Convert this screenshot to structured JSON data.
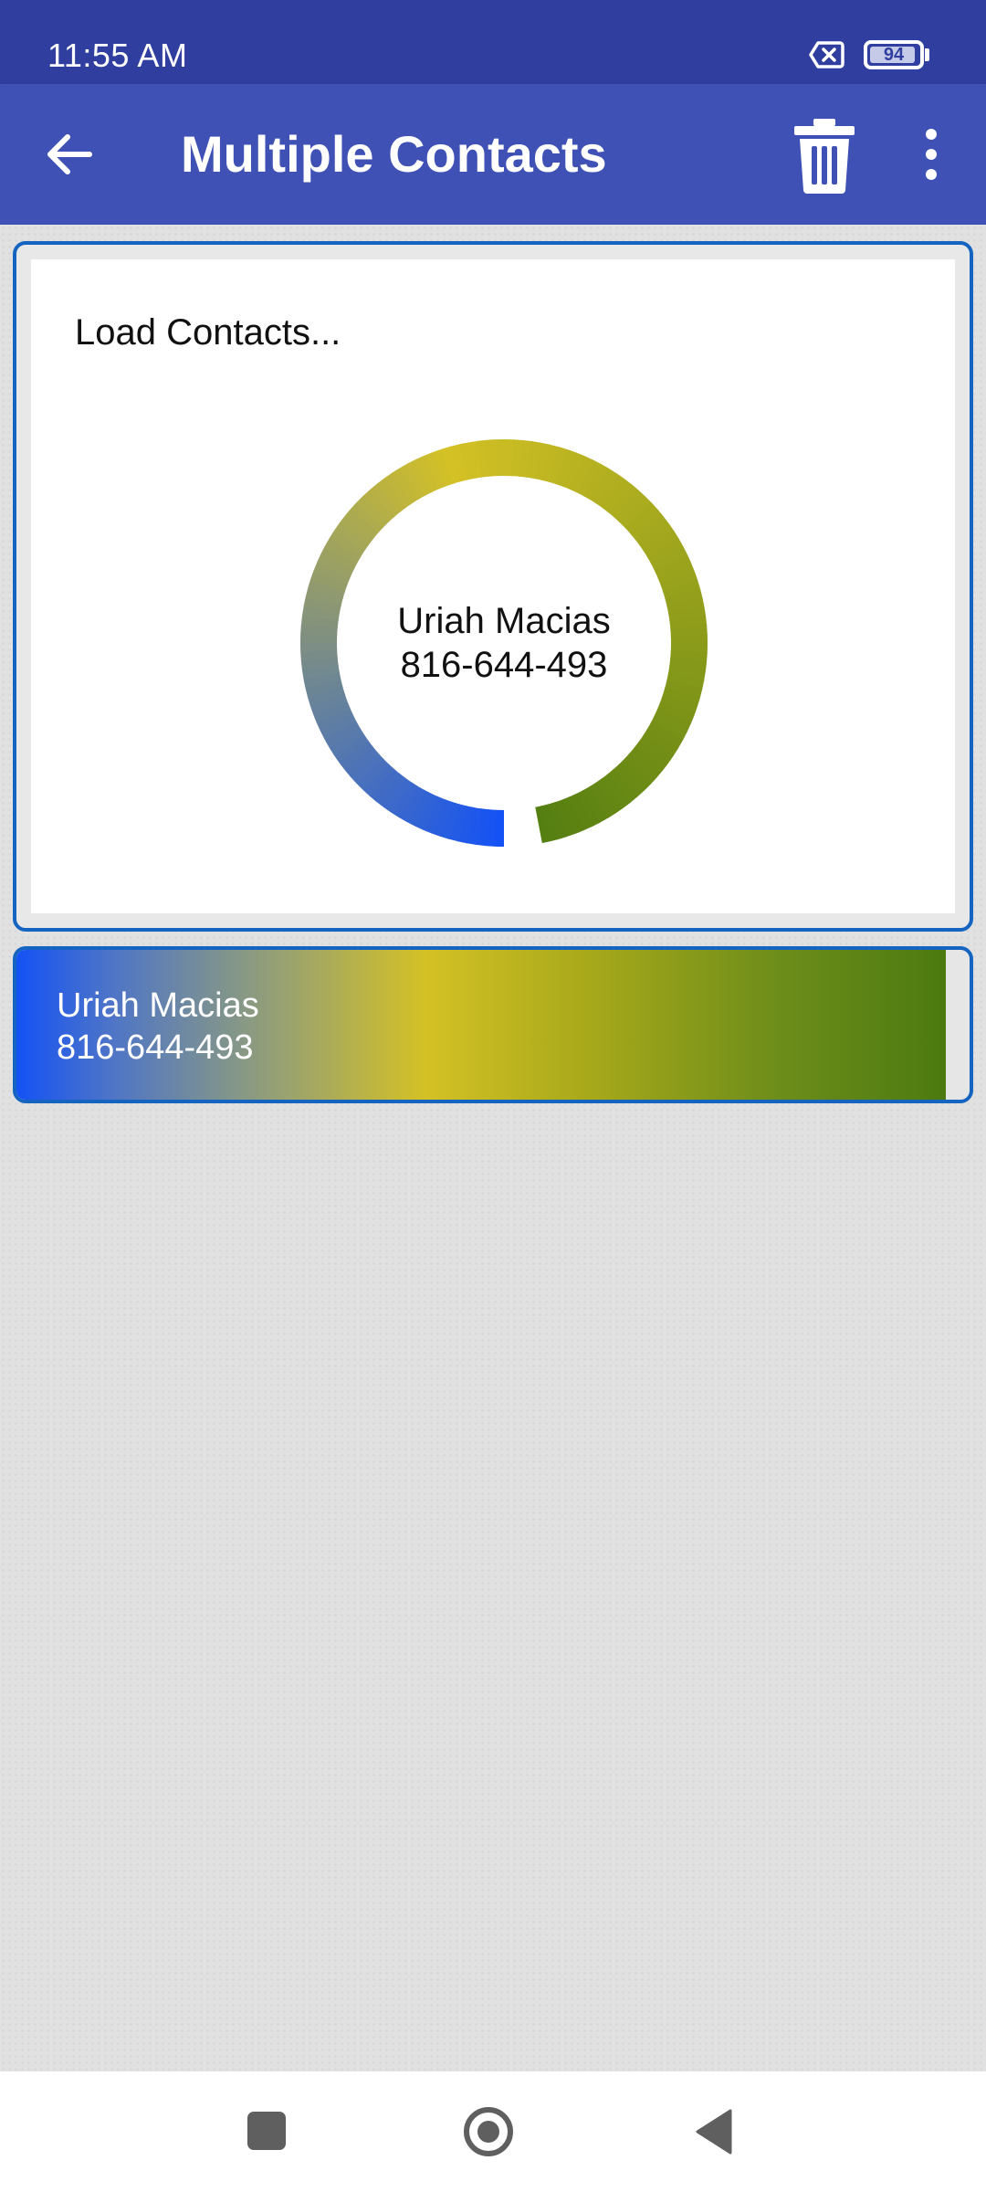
{
  "status_bar": {
    "time": "11:55 AM",
    "battery_level": "94",
    "icons": [
      "no-sim-icon",
      "battery-icon"
    ]
  },
  "toolbar": {
    "title": "Multiple Contacts",
    "icons": [
      "back-arrow-icon",
      "trash-icon",
      "more-vert-icon"
    ]
  },
  "loader_card": {
    "title": "Load Contacts...",
    "contact_name": "Uriah Macias",
    "contact_phone": "816-644-493",
    "progress_fraction": 0.97
  },
  "contact_item": {
    "name": "Uriah Macias",
    "phone": "816-644-493",
    "progress_fraction": 0.975
  },
  "colors": {
    "status_bar": "#303f9f",
    "toolbar": "#3f51b5",
    "card_border": "#1565c0",
    "gradient_start": "#1452f5",
    "gradient_mid": "#d4c125",
    "gradient_end": "#4c7a10",
    "background": "#e1e1e1"
  },
  "nav_bar": {
    "icons": [
      "recent-apps-icon",
      "home-icon",
      "back-icon"
    ]
  }
}
